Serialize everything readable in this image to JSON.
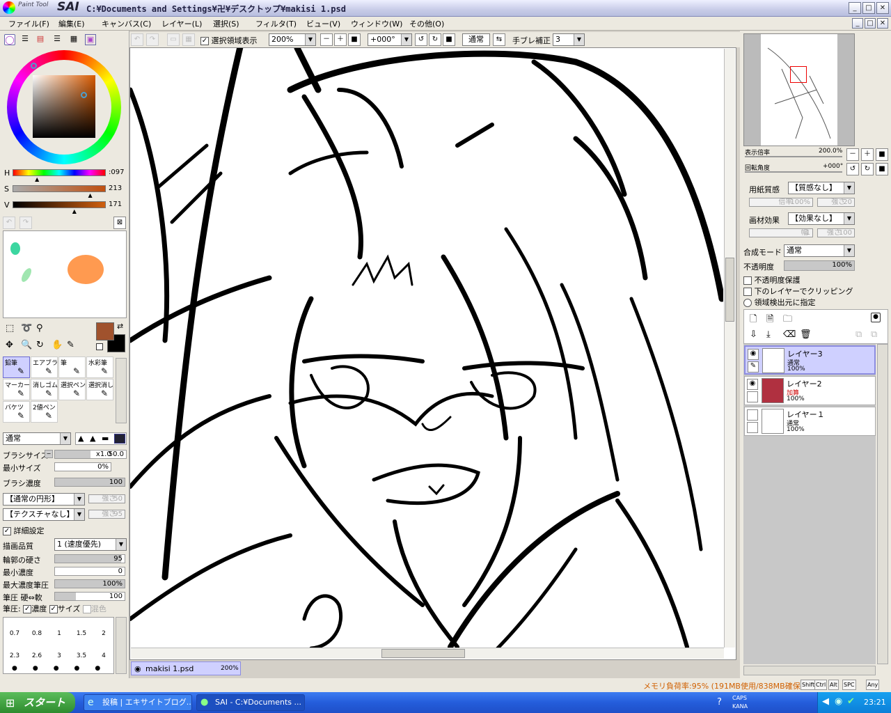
{
  "window": {
    "brand_small": "Paint Tool",
    "brand_big": "SAI",
    "title": "C:¥Documents and Settings¥卍¥デスクトップ¥makisi 1.psd"
  },
  "menu": [
    "ファイル(F)",
    "編集(E)",
    "キャンバス(C)",
    "レイヤー(L)",
    "選択(S)",
    "フィルタ(T)",
    "ビュー(V)",
    "ウィンドウ(W)",
    "その他(O)"
  ],
  "toolbar": {
    "show_selection_label": "選択領域表示",
    "show_selection_checked": true,
    "zoom": "200%",
    "rotation": "+000°",
    "blend": "通常",
    "stabilizer_label": "手ブレ補正",
    "stabilizer": "3"
  },
  "color": {
    "h_label": "H",
    "h_value": ":097",
    "s_label": "S",
    "s_value": "213",
    "v_label": "V",
    "v_value": "171",
    "h_frac": 0.27,
    "s_frac": 0.84,
    "v_frac": 0.67,
    "primary": "#a0522d",
    "secondary": "#000000"
  },
  "scratchpad_colors": [
    "#3cd6a0",
    "#a0e6b0",
    "#ff9a50"
  ],
  "tools": [
    {
      "name": "鉛筆",
      "sel": true
    },
    {
      "name": "エアブラシ"
    },
    {
      "name": "筆"
    },
    {
      "name": "水彩筆"
    },
    {
      "name": "マーカー"
    },
    {
      "name": "消しゴム"
    },
    {
      "name": "選択ペン"
    },
    {
      "name": "選択消し"
    },
    {
      "name": "バケツ"
    },
    {
      "name": "2値ペン"
    }
  ],
  "brush": {
    "mode": "通常",
    "size_label": "ブラシサイズ",
    "size_mult": "x1.0",
    "size_value": "50.0",
    "min_size_label": "最小サイズ",
    "min_size_value": "0%",
    "density_label": "ブラシ濃度",
    "density_value": "100",
    "shape": "【通常の円形】",
    "shape_strength_label": "強さ",
    "shape_strength": "50",
    "texture": "【テクスチャなし】",
    "texture_strength_label": "強さ",
    "texture_strength": "95",
    "detail_label": "詳細設定",
    "quality_label": "描画品質",
    "quality_value": "1 (速度優先)",
    "edge_label": "輪郭の硬さ",
    "edge_value": "95",
    "min_density_label": "最小濃度",
    "min_density_value": "0",
    "max_pressure_label": "最大濃度筆圧",
    "max_pressure_value": "100%",
    "pressure_hard_label": "筆圧 硬⇔軟",
    "pressure_hard_value": "100",
    "pressure_label": "筆圧:",
    "pressure_density_label": "濃度",
    "pressure_size_label": "サイズ",
    "mix_label": "混色"
  },
  "brush_sizes": [
    [
      "0.7",
      "0.8",
      "1",
      "1.5",
      "2"
    ],
    [
      "2.3",
      "2.6",
      "3",
      "3.5",
      "4"
    ]
  ],
  "navigator": {
    "zoom_label": "表示倍率",
    "zoom_value": "200.0%",
    "rotate_label": "回転角度",
    "rotate_value": "+000°"
  },
  "paper": {
    "texture_label": "用紙質感",
    "texture_value": "【質感なし】",
    "scale_label": "倍率",
    "scale_value": "100%",
    "strength_label": "強さ",
    "strength_value": "20",
    "effect_label": "画材効果",
    "effect_value": "【効果なし】",
    "width_label": "幅",
    "width_value": "1",
    "effect_strength_label": "強さ",
    "effect_strength_value": "100"
  },
  "layer_props": {
    "blend_label": "合成モード",
    "blend_value": "通常",
    "opacity_label": "不透明度",
    "opacity_value": "100%",
    "opt1": "不透明度保護",
    "opt2": "下のレイヤーでクリッピング",
    "opt3": "領域検出元に指定"
  },
  "layers": [
    {
      "name": "レイヤー3",
      "mode": "通常",
      "opacity": "100%",
      "visible": true,
      "sel": true,
      "thumb": "#ffffff"
    },
    {
      "name": "レイヤー2",
      "mode": "加算",
      "opacity": "100%",
      "visible": true,
      "sel": false,
      "thumb": "#b03040"
    },
    {
      "name": "レイヤー１",
      "mode": "通常",
      "opacity": "100%",
      "visible": false,
      "sel": false,
      "thumb": "#ffffff"
    }
  ],
  "doc_tab": {
    "name": "makisi 1.psd",
    "zoom": "200%"
  },
  "status": {
    "memory": "メモリ負荷率:95% (191MB使用/838MB確保)",
    "keys": [
      "Shift",
      "Ctrl",
      "Alt",
      "SPC",
      "Any"
    ]
  },
  "taskbar": {
    "start": "スタート",
    "tasks": [
      "投稿 | エキサイトブログ...",
      "SAI - C:¥Documents ..."
    ],
    "ime1": "CAPS",
    "ime2": "KANA",
    "time": "23:21"
  }
}
